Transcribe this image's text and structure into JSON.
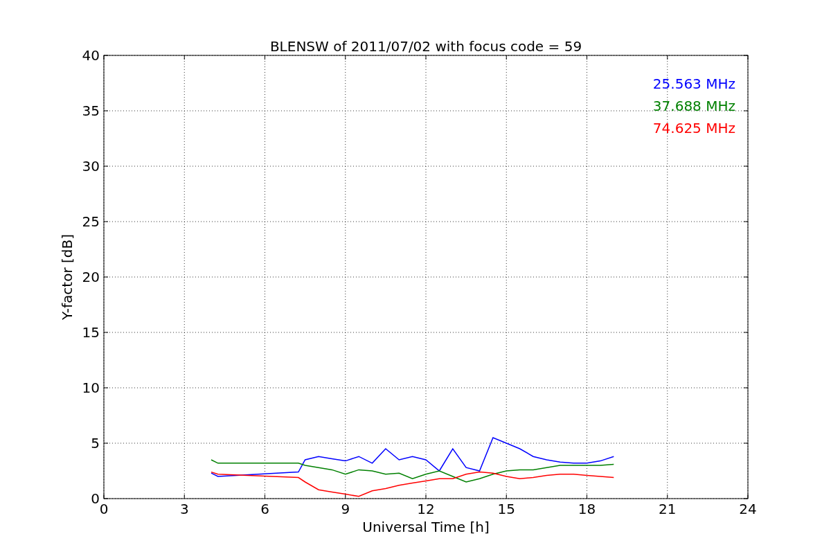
{
  "chart_data": {
    "type": "line",
    "title": "BLENSW of 2011/07/02 with focus code = 59",
    "xlabel": "Universal Time [h]",
    "ylabel": "Y-factor [dB]",
    "x": [
      4,
      4.25,
      7.25,
      7.5,
      8,
      8.5,
      9,
      9.5,
      10,
      10.5,
      11,
      11.5,
      12,
      12.5,
      13,
      13.5,
      14,
      14.5,
      15,
      15.5,
      16,
      16.5,
      17,
      17.5,
      18,
      18.5,
      19
    ],
    "series": [
      {
        "name": "25.563 MHz",
        "color": "#0000ff",
        "values": [
          2.3,
          2.0,
          2.4,
          3.5,
          3.8,
          3.6,
          3.4,
          3.8,
          3.2,
          4.5,
          3.5,
          3.8,
          3.5,
          2.5,
          4.5,
          2.8,
          2.5,
          5.5,
          5.0,
          4.5,
          3.8,
          3.5,
          3.3,
          3.2,
          3.2,
          3.4,
          3.8
        ]
      },
      {
        "name": "37.688 MHz",
        "color": "#008000",
        "values": [
          3.5,
          3.2,
          3.2,
          3.0,
          2.8,
          2.6,
          2.2,
          2.6,
          2.5,
          2.2,
          2.3,
          1.8,
          2.2,
          2.5,
          2.0,
          1.5,
          1.8,
          2.2,
          2.5,
          2.6,
          2.6,
          2.8,
          3.0,
          3.0,
          3.0,
          3.0,
          3.1
        ]
      },
      {
        "name": "74.625 MHz",
        "color": "#ff0000",
        "values": [
          2.4,
          2.2,
          1.9,
          1.5,
          0.8,
          0.6,
          0.4,
          0.2,
          0.7,
          0.9,
          1.2,
          1.4,
          1.6,
          1.8,
          1.8,
          2.2,
          2.4,
          2.3,
          2.0,
          1.8,
          1.9,
          2.1,
          2.2,
          2.2,
          2.1,
          2.0,
          1.9
        ]
      }
    ],
    "grid": true,
    "xlim": [
      0,
      24
    ],
    "ylim": [
      0,
      40
    ],
    "xticks": [
      0,
      3,
      6,
      9,
      12,
      15,
      18,
      21,
      24
    ],
    "yticks": [
      0,
      5,
      10,
      15,
      20,
      25,
      30,
      35,
      40
    ]
  }
}
